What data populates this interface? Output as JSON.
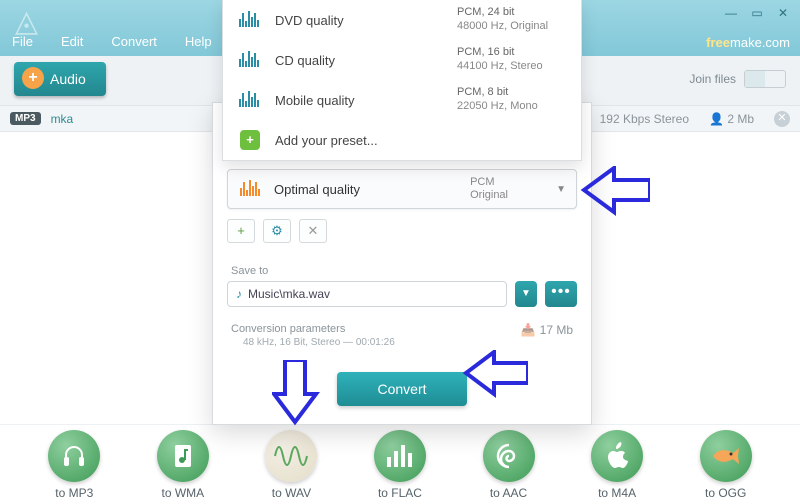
{
  "menu": {
    "file": "File",
    "edit": "Edit",
    "convert": "Convert",
    "help": "Help"
  },
  "brand": {
    "free": "free",
    "make": "make.com"
  },
  "audio_button": "Audio",
  "join": {
    "label": "Join files"
  },
  "file_row": {
    "badge": "MP3",
    "name": "mka",
    "info": "192 Kbps  Stereo",
    "size": "2 Mb",
    "size_icon_label": "👤"
  },
  "presets": {
    "dvd": {
      "name": "DVD quality",
      "codec": "PCM, 24 bit",
      "detail": "48000 Hz,  Original"
    },
    "cd": {
      "name": "CD quality",
      "codec": "PCM, 16 bit",
      "detail": "44100 Hz,  Stereo"
    },
    "mobile": {
      "name": "Mobile quality",
      "codec": "PCM, 8 bit",
      "detail": "22050 Hz,  Mono"
    },
    "add": {
      "name": "Add your preset..."
    }
  },
  "selected": {
    "name": "Optimal quality",
    "codec": "PCM",
    "detail": "Original"
  },
  "tools": {
    "add": "+",
    "gear": "⚙",
    "del": "✕"
  },
  "save_to_label": "Save to",
  "save_path": "Music\\mka.wav",
  "conv": {
    "title": "Conversion parameters",
    "line": "48 kHz, 16 Bit, Stereo — 00:01:26",
    "size": "17 Mb"
  },
  "convert_label": "Convert",
  "formats": {
    "mp3": "to MP3",
    "wma": "to WMA",
    "wav": "to WAV",
    "flac": "to FLAC",
    "aac": "to AAC",
    "m4a": "to M4A",
    "ogg": "to OGG"
  }
}
